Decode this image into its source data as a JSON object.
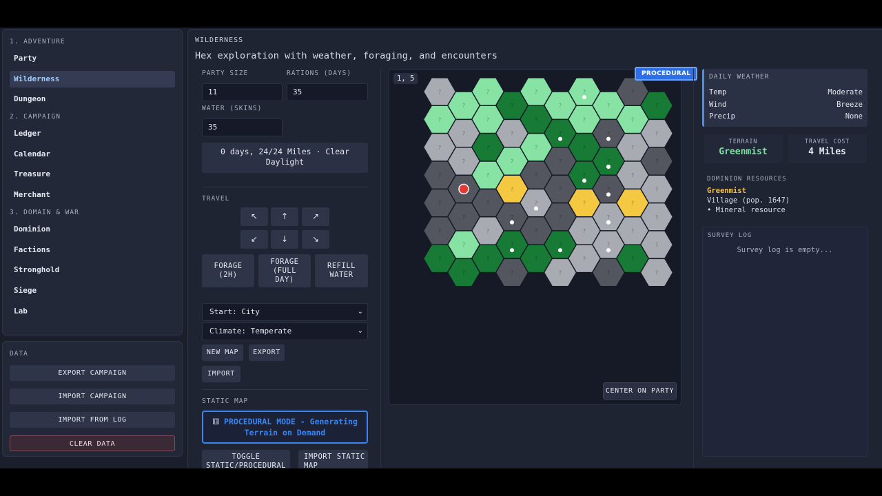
{
  "sidebar": {
    "sections": [
      {
        "title": "1. ADVENTURE",
        "items": [
          "Party",
          "Wilderness",
          "Dungeon"
        ]
      },
      {
        "title": "2. CAMPAIGN",
        "items": [
          "Ledger",
          "Calendar",
          "Treasure",
          "Merchant"
        ]
      },
      {
        "title": "3. DOMAIN & WAR",
        "items": [
          "Dominion",
          "Factions",
          "Stronghold",
          "Siege",
          "Lab"
        ]
      }
    ],
    "active_item": "Wilderness",
    "data": {
      "title": "DATA",
      "export": "EXPORT CAMPAIGN",
      "import": "IMPORT CAMPAIGN",
      "import_log": "IMPORT FROM LOG",
      "clear": "CLEAR DATA"
    }
  },
  "main": {
    "title": "WILDERNESS",
    "subtitle": "Hex exploration with weather, foraging, and encounters"
  },
  "controls": {
    "party_size_label": "PARTY SIZE",
    "party_size": "11",
    "rations_label": "RATIONS (DAYS)",
    "rations": "35",
    "water_label": "WATER (SKINS)",
    "water": "35",
    "status": "0 days, 24/24 Miles · Clear Daylight",
    "travel_label": "TRAVEL",
    "arrows": {
      "nw": "↖",
      "n": "↑",
      "ne": "↗",
      "sw": "↙",
      "s": "↓",
      "se": "↘"
    },
    "forage_2h": "FORAGE (2H)",
    "forage_full": "FORAGE (FULL DAY)",
    "refill": "REFILL WATER",
    "start_select": "Start: City",
    "climate_select": "Climate: Temperate",
    "new_map": "NEW MAP",
    "export": "EXPORT",
    "import": "IMPORT",
    "static_map_label": "STATIC MAP",
    "procedural_mode": "PROCEDURAL MODE - Generating Terrain on Demand",
    "toggle": "TOGGLE STATIC/PROCEDURAL",
    "import_static": "IMPORT STATIC MAP"
  },
  "map": {
    "coords": "1, 5",
    "badge": "PROCEDURAL",
    "center_button": "CENTER ON PARTY",
    "hex_mark": "?",
    "colors": {
      "L": "#86e3a4",
      "D": "#177a35",
      "G": "#a9abb3",
      "K": "#53565e",
      "Y": "#f5c842",
      "O": "#f5b878",
      "B": "#1e3f94"
    },
    "rows": [
      "GLLLKYLB",
      "LDLLDGGLB",
      "LLDLLOGDB",
      "GGDKGGGLB",
      "GDLDGGGGB",
      "GLKDKGGLB",
      "KLKDGDYLB",
      "KYKKGGGGB",
      "KKGYYGGLB",
      "KKKGGGGLB",
      "KGKGGYGGB",
      "LDDGGKGLB",
      "DDDGDGKLB",
      "DKGKGGB"
    ],
    "dots": [
      [
        0,
        6
      ],
      [
        2,
        5
      ],
      [
        3,
        7
      ],
      [
        4,
        7
      ],
      [
        5,
        7
      ],
      [
        6,
        6
      ],
      [
        6,
        7
      ],
      [
        7,
        7
      ],
      [
        8,
        3
      ],
      [
        8,
        4
      ],
      [
        8,
        7
      ],
      [
        9,
        4
      ],
      [
        9,
        7
      ],
      [
        10,
        5
      ],
      [
        10,
        7
      ],
      [
        11,
        3
      ],
      [
        11,
        7
      ]
    ],
    "party": [
      7,
      1
    ]
  },
  "weather": {
    "title": "DAILY WEATHER",
    "rows": [
      {
        "k": "Temp",
        "v": "Moderate"
      },
      {
        "k": "Wind",
        "v": "Breeze"
      },
      {
        "k": "Precip",
        "v": "None"
      }
    ]
  },
  "terrain": {
    "label": "TERRAIN",
    "value": "Greenmist"
  },
  "travel_cost": {
    "label": "TRAVEL COST",
    "value": "4 Miles"
  },
  "dominion": {
    "title": "DOMINION RESOURCES",
    "name": "Greenmist",
    "village": "Village (pop. 1647)",
    "resource": "• Mineral resource"
  },
  "survey": {
    "title": "SURVEY LOG",
    "empty": "Survey log is empty..."
  }
}
